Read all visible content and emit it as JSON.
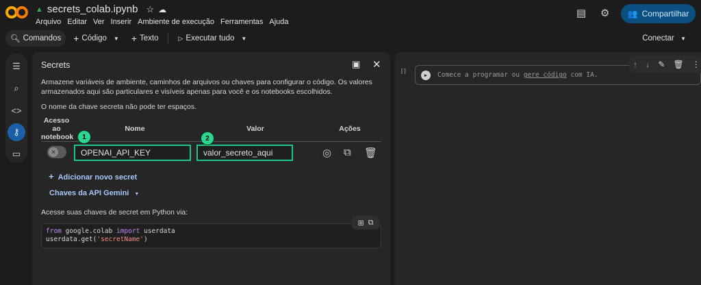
{
  "header": {
    "filename": "secrets_colab.ipynb",
    "menu": [
      "Arquivo",
      "Editar",
      "Ver",
      "Inserir",
      "Ambiente de execução",
      "Ferramentas",
      "Ajuda"
    ],
    "share_label": "Compartilhar"
  },
  "toolbar": {
    "commands": "Comandos",
    "code": "Código",
    "text": "Texto",
    "run_all": "Executar tudo",
    "connect": "Conectar"
  },
  "secrets": {
    "title": "Secrets",
    "description": "Armazene variáveis de ambiente, caminhos de arquivos ou chaves para configurar o código. Os valores armazenados aqui são particulares e visíveis apenas para você e os notebooks escolhidos.",
    "rule": "O nome da chave secreta não pode ter espaços.",
    "columns": {
      "access": "Acesso ao notebook",
      "name": "Nome",
      "value": "Valor",
      "actions": "Ações"
    },
    "rows": [
      {
        "name": "OPENAI_API_KEY",
        "value": "valor_secreto_aqui",
        "access_enabled": false
      }
    ],
    "badges": [
      "1",
      "2"
    ],
    "add_label": "Adicionar novo secret",
    "gemini_label": "Chaves da API Gemini",
    "access_hint": "Acesse suas chaves de secret em Python via:",
    "code": {
      "l1_kw1": "from",
      "l1_mod": " google.colab ",
      "l1_kw2": "import",
      "l1_name": " userdata",
      "l2_pre": "userdata.get(",
      "l2_str": "'secretName'",
      "l2_post": ")"
    }
  },
  "notebook": {
    "cell_bracket": "[ ]",
    "placeholder_pre": "Comece a programar ou ",
    "placeholder_link": "gere código",
    "placeholder_post": " com IA."
  },
  "colors": {
    "accent": "#1ec98a",
    "share": "#0b4f80",
    "active_rail": "#1b5fa8"
  }
}
